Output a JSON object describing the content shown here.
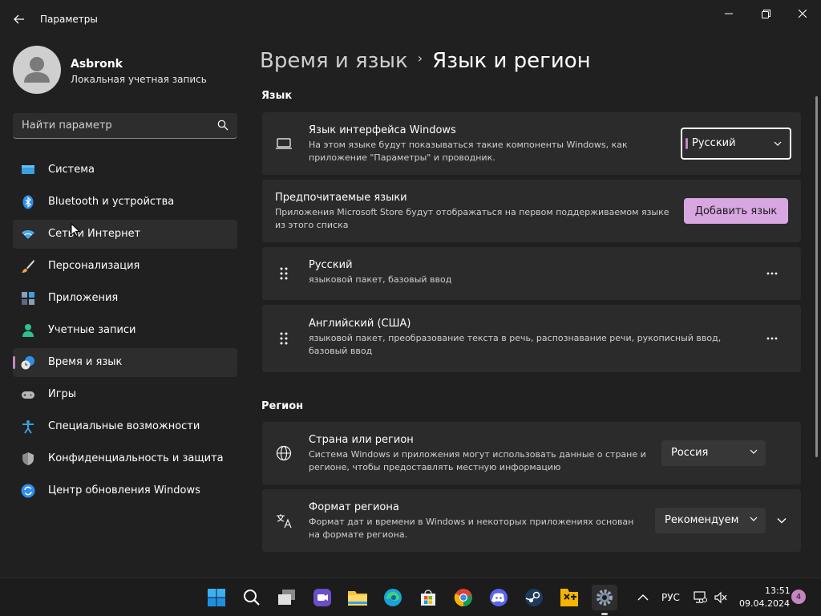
{
  "window": {
    "title": "Параметры"
  },
  "user": {
    "name": "Asbronk",
    "account_type": "Локальная учетная запись"
  },
  "search": {
    "placeholder": "Найти параметр"
  },
  "sidebar": {
    "items": [
      {
        "label": "Система",
        "icon": "monitor-icon"
      },
      {
        "label": "Bluetooth и устройства",
        "icon": "bluetooth-icon"
      },
      {
        "label": "Сеть и Интернет",
        "icon": "wifi-icon"
      },
      {
        "label": "Персонализация",
        "icon": "brush-icon"
      },
      {
        "label": "Приложения",
        "icon": "apps-icon"
      },
      {
        "label": "Учетные записи",
        "icon": "person-icon"
      },
      {
        "label": "Время и язык",
        "icon": "clock-globe-icon"
      },
      {
        "label": "Игры",
        "icon": "gamepad-icon"
      },
      {
        "label": "Специальные возможности",
        "icon": "accessibility-icon"
      },
      {
        "label": "Конфиденциальность и защита",
        "icon": "shield-icon"
      },
      {
        "label": "Центр обновления Windows",
        "icon": "update-icon"
      }
    ],
    "active_index": 6,
    "hover_index": 2
  },
  "breadcrumb": {
    "parent": "Время и язык",
    "separator": "›",
    "current": "Язык и регион"
  },
  "language_section": {
    "title": "Язык",
    "display_language": {
      "title": "Язык интерфейса Windows",
      "desc_line1": "На этом языке будут показываться такие компоненты Windows, как",
      "desc_line2": "приложение \"Параметры\" и проводник.",
      "value": "Русский"
    },
    "preferred": {
      "title": "Предпочитаемые языки",
      "desc_line1": "Приложения Microsoft Store будут отображаться на первом поддерживаемом языке",
      "desc_line2": "из этого списка",
      "button": "Добавить язык"
    },
    "languages": [
      {
        "name": "Русский",
        "desc_line1": "языковой пакет, базовый ввод",
        "desc_line2": ""
      },
      {
        "name": "Английский (США)",
        "desc_line1": "языковой пакет, преобразование текста в речь, распознавание речи, рукописный ввод,",
        "desc_line2": "базовый ввод"
      }
    ]
  },
  "region_section": {
    "title": "Регион",
    "country": {
      "title": "Страна или регион",
      "desc_line1": "Система Windows и приложения могут использовать данные о стране и",
      "desc_line2": "регионе, чтобы предоставлять местную информацию",
      "value": "Россия"
    },
    "format": {
      "title": "Формат региона",
      "desc_line1": "Формат дат и времени в Windows и некоторых приложениях основан",
      "desc_line2": "на формате региона.",
      "value": "Рекомендуем"
    }
  },
  "taskbar": {
    "apps": [
      "start-icon",
      "search-icon",
      "task-view-icon",
      "clipchamp-icon",
      "file-explorer-icon",
      "edge-icon",
      "store-icon",
      "chrome-icon",
      "discord-icon",
      "steam-icon",
      "app-icon",
      "settings-icon"
    ],
    "tray": {
      "lang": "РУС",
      "time": "13:51",
      "date": "09.04.2024",
      "notifications": "4"
    }
  },
  "colors": {
    "accent": "#d8a7e1",
    "accent_bar": "#c586c0",
    "background": "#202020",
    "card": "#2b2b2b"
  }
}
